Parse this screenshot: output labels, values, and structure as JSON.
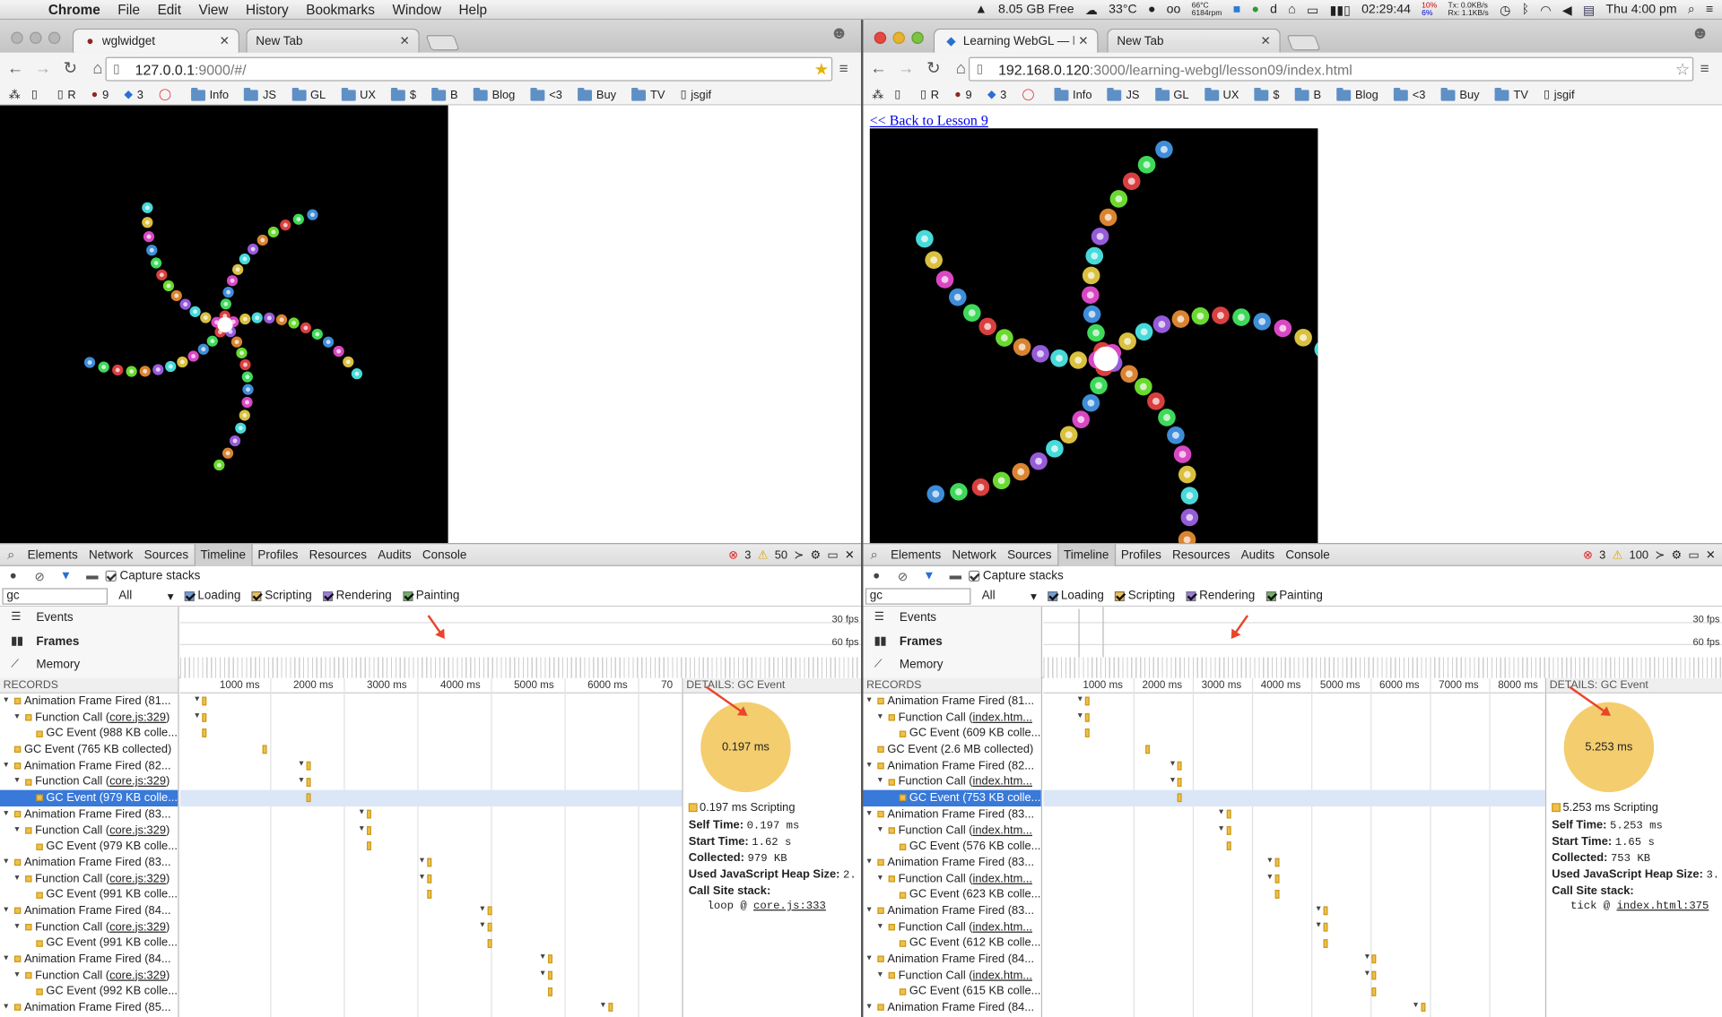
{
  "menubar": {
    "app": "Chrome",
    "items": [
      "File",
      "Edit",
      "View",
      "History",
      "Bookmarks",
      "Window",
      "Help"
    ],
    "free_space": "8.05 GB Free",
    "weather": "33°C",
    "cpu_temp": "66°C",
    "fan": "6184rpm",
    "battery_time": "02:29:44",
    "cpu_pct_a": "10%",
    "cpu_pct_b": "6%",
    "net_tx": "Tx:   0.0KB/s",
    "net_rx": "Rx:   1.1KB/s",
    "clock": "Thu 4:00 pm"
  },
  "left": {
    "tabs": [
      {
        "label": "wglwidget"
      },
      {
        "label": "New Tab"
      }
    ],
    "url_host": "127.0.0.1",
    "url_rest": ":9000/#/",
    "bookmarks": [
      "R",
      "9",
      "3",
      "",
      "Info",
      "JS",
      "GL",
      "UX",
      "$",
      "B",
      "Blog",
      "<3",
      "Buy",
      "TV",
      "jsgif"
    ],
    "devtools": {
      "tabs": [
        "Elements",
        "Network",
        "Sources",
        "Timeline",
        "Profiles",
        "Resources",
        "Audits",
        "Console"
      ],
      "errors": "3",
      "warnings": "50",
      "capture": "Capture stacks",
      "filter": "gc",
      "all": "All",
      "cats": [
        "Loading",
        "Scripting",
        "Rendering",
        "Painting"
      ],
      "overview": [
        "Events",
        "Frames",
        "Memory"
      ],
      "fps30": "30 fps",
      "fps60": "60 fps",
      "records_header": "RECORDS",
      "records": [
        {
          "t": "Animation Frame Fired (81...",
          "d": 0,
          "tri": "▼"
        },
        {
          "t": "Function Call (",
          "l": "core.js:329",
          "e": ")",
          "d": 1,
          "tri": "▼"
        },
        {
          "t": "GC Event (988 KB colle...",
          "d": 2,
          "tri": ""
        },
        {
          "t": "GC Event (765 KB collected)",
          "d": 0,
          "tri": ""
        },
        {
          "t": "Animation Frame Fired (82...",
          "d": 0,
          "tri": "▼"
        },
        {
          "t": "Function Call (",
          "l": "core.js:329",
          "e": ")",
          "d": 1,
          "tri": "▼"
        },
        {
          "t": "GC Event (979 KB colle...",
          "d": 2,
          "tri": "",
          "sel": true
        },
        {
          "t": "Animation Frame Fired (83...",
          "d": 0,
          "tri": "▼"
        },
        {
          "t": "Function Call (",
          "l": "core.js:329",
          "e": ")",
          "d": 1,
          "tri": "▼"
        },
        {
          "t": "GC Event (979 KB colle...",
          "d": 2,
          "tri": ""
        },
        {
          "t": "Animation Frame Fired (83...",
          "d": 0,
          "tri": "▼"
        },
        {
          "t": "Function Call (",
          "l": "core.js:329",
          "e": ")",
          "d": 1,
          "tri": "▼"
        },
        {
          "t": "GC Event (991 KB colle...",
          "d": 2,
          "tri": ""
        },
        {
          "t": "Animation Frame Fired (84...",
          "d": 0,
          "tri": "▼"
        },
        {
          "t": "Function Call (",
          "l": "core.js:329",
          "e": ")",
          "d": 1,
          "tri": "▼"
        },
        {
          "t": "GC Event (991 KB colle...",
          "d": 2,
          "tri": ""
        },
        {
          "t": "Animation Frame Fired (84...",
          "d": 0,
          "tri": "▼"
        },
        {
          "t": "Function Call (",
          "l": "core.js:329",
          "e": ")",
          "d": 1,
          "tri": "▼"
        },
        {
          "t": "GC Event (992 KB colle...",
          "d": 2,
          "tri": ""
        },
        {
          "t": "Animation Frame Fired (85...",
          "d": 0,
          "tri": "▼"
        }
      ],
      "timeline_marks": [
        "1000 ms",
        "2000 ms",
        "3000 ms",
        "4000 ms",
        "5000 ms",
        "6000 ms",
        "70"
      ],
      "details_header": "DETAILS: GC Event",
      "pie_label": "0.197 ms",
      "legend": "0.197 ms Scripting",
      "self_time": "0.197 ms",
      "start_time": "1.62 s",
      "collected": "979 KB",
      "heap": "2.",
      "call_fn": "loop @ ",
      "call_link": "core.js:333"
    }
  },
  "right": {
    "tabs": [
      {
        "label": "Learning WebGL — lesson"
      },
      {
        "label": "New Tab"
      }
    ],
    "url_host": "192.168.0.120",
    "url_rest": ":3000/learning-webgl/lesson09/index.html",
    "back_link": "<< Back to Lesson 9",
    "bookmarks": [
      "R",
      "9",
      "3",
      "",
      "Info",
      "JS",
      "GL",
      "UX",
      "$",
      "B",
      "Blog",
      "<3",
      "Buy",
      "TV",
      "jsgif"
    ],
    "devtools": {
      "tabs": [
        "Elements",
        "Network",
        "Sources",
        "Timeline",
        "Profiles",
        "Resources",
        "Audits",
        "Console"
      ],
      "errors": "3",
      "warnings": "100",
      "capture": "Capture stacks",
      "filter": "gc",
      "all": "All",
      "cats": [
        "Loading",
        "Scripting",
        "Rendering",
        "Painting"
      ],
      "overview": [
        "Events",
        "Frames",
        "Memory"
      ],
      "fps30": "30 fps",
      "fps60": "60 fps",
      "records_header": "RECORDS",
      "records": [
        {
          "t": "Animation Frame Fired (81...",
          "d": 0,
          "tri": "▼"
        },
        {
          "t": "Function Call (",
          "l": "index.htm...",
          "e": "",
          "d": 1,
          "tri": "▼"
        },
        {
          "t": "GC Event (609 KB colle...",
          "d": 2,
          "tri": ""
        },
        {
          "t": "GC Event (2.6 MB collected)",
          "d": 0,
          "tri": ""
        },
        {
          "t": "Animation Frame Fired (82...",
          "d": 0,
          "tri": "▼"
        },
        {
          "t": "Function Call (",
          "l": "index.htm...",
          "e": "",
          "d": 1,
          "tri": "▼"
        },
        {
          "t": "GC Event (753 KB colle...",
          "d": 2,
          "tri": "",
          "sel": true
        },
        {
          "t": "Animation Frame Fired (83...",
          "d": 0,
          "tri": "▼"
        },
        {
          "t": "Function Call (",
          "l": "index.htm...",
          "e": "",
          "d": 1,
          "tri": "▼"
        },
        {
          "t": "GC Event (576 KB colle...",
          "d": 2,
          "tri": ""
        },
        {
          "t": "Animation Frame Fired (83...",
          "d": 0,
          "tri": "▼"
        },
        {
          "t": "Function Call (",
          "l": "index.htm...",
          "e": "",
          "d": 1,
          "tri": "▼"
        },
        {
          "t": "GC Event (623 KB colle...",
          "d": 2,
          "tri": ""
        },
        {
          "t": "Animation Frame Fired (83...",
          "d": 0,
          "tri": "▼"
        },
        {
          "t": "Function Call (",
          "l": "index.htm...",
          "e": "",
          "d": 1,
          "tri": "▼"
        },
        {
          "t": "GC Event (612 KB colle...",
          "d": 2,
          "tri": ""
        },
        {
          "t": "Animation Frame Fired (84...",
          "d": 0,
          "tri": "▼"
        },
        {
          "t": "Function Call (",
          "l": "index.htm...",
          "e": "",
          "d": 1,
          "tri": "▼"
        },
        {
          "t": "GC Event (615 KB colle...",
          "d": 2,
          "tri": ""
        },
        {
          "t": "Animation Frame Fired (84...",
          "d": 0,
          "tri": "▼"
        }
      ],
      "timeline_marks": [
        "1000 ms",
        "2000 ms",
        "3000 ms",
        "4000 ms",
        "5000 ms",
        "6000 ms",
        "7000 ms",
        "8000 ms"
      ],
      "details_header": "DETAILS: GC Event",
      "pie_label": "5.253 ms",
      "legend": "5.253 ms Scripting",
      "self_time": "5.253 ms",
      "start_time": "1.65 s",
      "collected": "753 KB",
      "heap": "3.",
      "call_fn": "tick @ ",
      "call_link": "index.html:375"
    }
  },
  "detail_labels": {
    "self": "Self Time:",
    "start": "Start Time:",
    "collected": "Collected:",
    "heap": "Used JavaScript Heap Size:",
    "stack": "Call Site stack:"
  },
  "colors": {
    "scripting": "#f1c04c",
    "selection": "#3879d9",
    "annotation_arrow": "#e8452b"
  }
}
